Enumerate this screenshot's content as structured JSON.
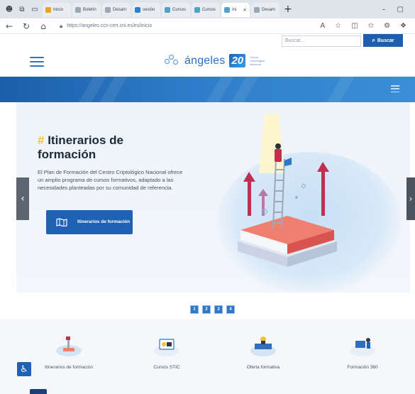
{
  "browser": {
    "tabs": [
      {
        "label": "Inicio",
        "fav": "y"
      },
      {
        "label": "Boletín",
        "fav": ""
      },
      {
        "label": "Desam",
        "fav": ""
      },
      {
        "label": "sesión",
        "fav": "b"
      },
      {
        "label": "Cursos",
        "fav": "t"
      },
      {
        "label": "Cursos",
        "fav": "t"
      },
      {
        "label": "Ini",
        "fav": "t",
        "active": true
      },
      {
        "label": "Desam",
        "fav": ""
      }
    ],
    "new_tab": "+",
    "url": "https://angeles.ccn-cert.cni.es/es/inicio"
  },
  "header": {
    "search_placeholder": "Buscar...",
    "search_button": "Buscar",
    "logo_text": "ángeles",
    "logo_number": "20",
    "logo_subtitle": "Centro Criptológico Nacional"
  },
  "hero": {
    "title_hash": "#",
    "title": "Itinerarios de formación",
    "description": "El Plan de Formación del Centro Criptológico Nacional ofrece un amplio programa de cursos formativos, adaptado a las necesidades planteadas por su comunidad de referencia.",
    "cta_label": "Itinerarios de formación"
  },
  "pager": [
    "1",
    "2",
    "3",
    "4"
  ],
  "categories": [
    {
      "label": "Itinerarios de formación"
    },
    {
      "label": "Cursos STIC"
    },
    {
      "label": "Oferta formativa"
    },
    {
      "label": "Formación 360"
    }
  ],
  "colors": {
    "brand_blue": "#1f62b3",
    "accent_yellow": "#f1c232",
    "arrow_red": "#c0304e"
  }
}
